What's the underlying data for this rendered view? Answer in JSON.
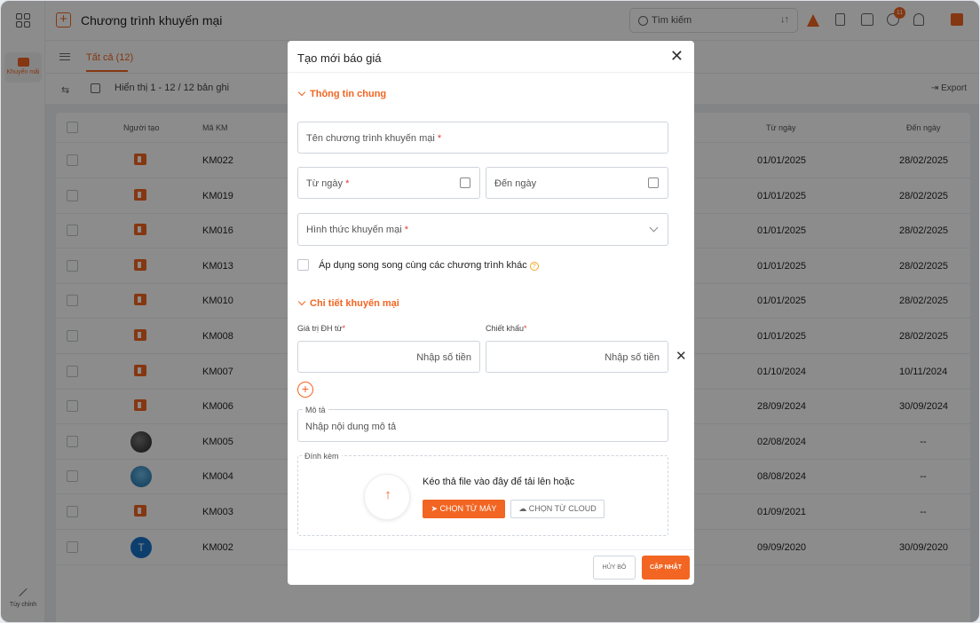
{
  "rail": {
    "promo_label": "Khuyến mãi",
    "custom_label": "Tùy chỉnh"
  },
  "header": {
    "title": "Chương trình khuyến mại",
    "search_placeholder": "Tìm kiếm",
    "notification_count": "11"
  },
  "tabs": {
    "all_label": "Tất cả (12)"
  },
  "toolbar": {
    "info": "Hiển thị 1 - 12 / 12 bản ghi",
    "export_label": "Export"
  },
  "table": {
    "columns": {
      "creator": "Người tạo",
      "code": "Mã KM",
      "from": "Từ ngày",
      "to": "Đến ngày"
    },
    "rows": [
      {
        "avatar": "brand",
        "code": "KM022",
        "from": "01/01/2025",
        "to": "28/02/2025"
      },
      {
        "avatar": "brand",
        "code": "KM019",
        "from": "01/01/2025",
        "to": "28/02/2025"
      },
      {
        "avatar": "brand",
        "code": "KM016",
        "from": "01/01/2025",
        "to": "28/02/2025"
      },
      {
        "avatar": "brand",
        "code": "KM013",
        "from": "01/01/2025",
        "to": "28/02/2025"
      },
      {
        "avatar": "brand",
        "code": "KM010",
        "from": "01/01/2025",
        "to": "28/02/2025"
      },
      {
        "avatar": "brand",
        "code": "KM008",
        "from": "01/01/2025",
        "to": "28/02/2025"
      },
      {
        "avatar": "brand",
        "code": "KM007",
        "from": "01/10/2024",
        "to": "10/11/2024"
      },
      {
        "avatar": "brand",
        "code": "KM006",
        "from": "28/09/2024",
        "to": "30/09/2024"
      },
      {
        "avatar": "photo1",
        "code": "KM005",
        "from": "02/08/2024",
        "to": "--"
      },
      {
        "avatar": "photo2",
        "code": "KM004",
        "from": "08/08/2024",
        "to": "--"
      },
      {
        "avatar": "brand",
        "code": "KM003",
        "from": "01/09/2021",
        "to": "--"
      },
      {
        "avatar": "letter",
        "letter": "T",
        "code": "KM002",
        "from": "09/09/2020",
        "to": "30/09/2020"
      }
    ]
  },
  "modal": {
    "title": "Tạo mới báo giá",
    "section_general": "Thông tin chung",
    "name_placeholder": "Tên chương trình khuyến mại",
    "from_placeholder": "Từ ngày",
    "to_placeholder": "Đến ngày",
    "type_placeholder": "Hình thức khuyến mại",
    "required_mark": "*",
    "parallel_label": "Áp dụng song song cùng các chương trình khác",
    "help_mark": "?",
    "section_detail": "Chi tiết khuyến mại",
    "order_value_label": "Giá trị ĐH từ",
    "discount_label": "Chiết khấu",
    "amount_placeholder": "Nhập số tiền",
    "description_label": "Mô tả",
    "description_placeholder": "Nhập nội dung mô tả",
    "attach_label": "Đính kèm",
    "drop_text": "Kéo thả file vào đây để tải lên hoặc",
    "choose_local": "CHỌN TỪ MÁY",
    "choose_cloud": "CHỌN TỪ CLOUD",
    "cancel": "HỦY BỎ",
    "save": "CẬP NHẬT"
  },
  "colors": {
    "accent": "#f26522",
    "required": "#e53935"
  }
}
